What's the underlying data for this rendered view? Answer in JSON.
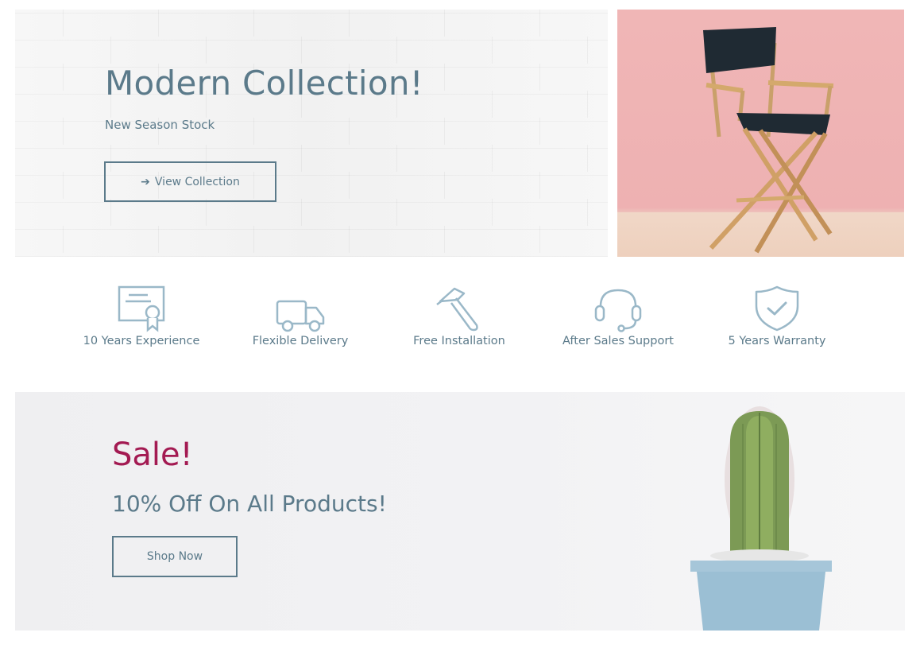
{
  "hero": {
    "title": "Modern Collection!",
    "subtitle": "New Season Stock",
    "button_label": "View Collection",
    "button_arrow": "➔",
    "image": "director-chair-on-pink-background"
  },
  "features": [
    {
      "label": "10 Years Experience",
      "icon": "certificate-icon"
    },
    {
      "label": "Flexible Delivery",
      "icon": "delivery-truck-icon"
    },
    {
      "label": "Free Installation",
      "icon": "hammer-icon"
    },
    {
      "label": "After Sales Support",
      "icon": "headset-icon"
    },
    {
      "label": "5 Years Warranty",
      "icon": "shield-check-icon"
    }
  ],
  "sale": {
    "title": "Sale!",
    "subtitle": "10% Off On All Products!",
    "button_label": "Shop Now",
    "image": "cactus-in-blue-pot"
  },
  "colors": {
    "text": "#5b7a8a",
    "accent": "#a31a52",
    "icon": "#9ab8c8",
    "pink_background": "#f0b6b6"
  }
}
